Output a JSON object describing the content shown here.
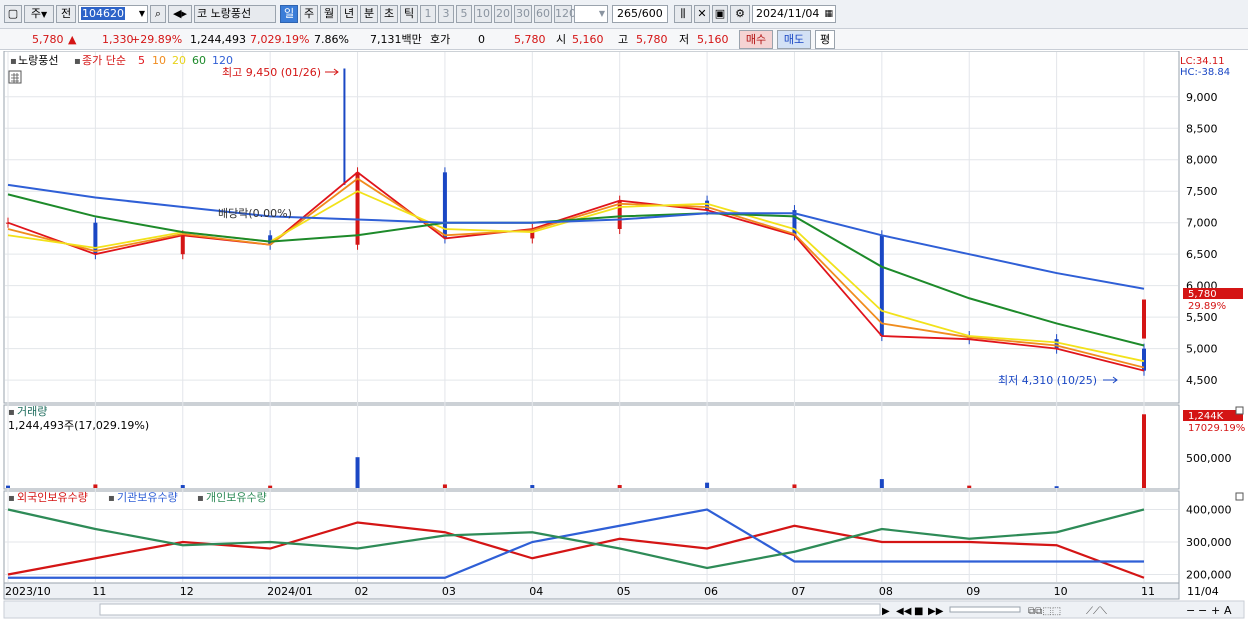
{
  "toolbar": {
    "market": "주",
    "prev_label": "전",
    "code": "104620",
    "market_short": "코",
    "stock_name": "노랑풍선",
    "period_tabs": [
      "일",
      "주",
      "월",
      "년",
      "분",
      "초",
      "틱"
    ],
    "active_period": "일",
    "interval_buttons": [
      "1",
      "3",
      "5",
      "10",
      "20",
      "30",
      "60",
      "120"
    ],
    "count": "265",
    "count_max": "/600",
    "date": "2024/11/04"
  },
  "quote": {
    "price": "5,780",
    "change": "1,330",
    "change_pct": "+29.89%",
    "volume": "1,244,493",
    "volume_ratio": "7,029.19%",
    "turnover": "7.86%",
    "amount": "7,131백만",
    "hoga_label": "호가",
    "hoga_value": "0",
    "hoga_price": "5,780",
    "open_label": "시",
    "open": "5,160",
    "high_label": "고",
    "high": "5,780",
    "low_label": "저",
    "low": "5,160",
    "buy_label": "매수",
    "sell_label": "매도",
    "avg_label": "평"
  },
  "price_panel": {
    "name": "노랑풍선",
    "ma_title": "종가 단순",
    "ma_periods": [
      "5",
      "10",
      "20",
      "60",
      "120"
    ],
    "max_label": "최고 9,450 (01/26)",
    "min_label": "최저 4,310 (10/25)",
    "dividend_label": "배당락(0.00%)",
    "lc_label": "LC:34.11",
    "hc_label": "HC:-38.84",
    "y_ticks": [
      "9,000",
      "8,500",
      "8,000",
      "7,500",
      "7,000",
      "6,500",
      "6,000",
      "5,500",
      "5,000",
      "4,500"
    ],
    "last_price_tag": "5,780",
    "last_pct_tag": "29.89%"
  },
  "volume_panel": {
    "title": "거래량",
    "subtitle": "1,244,493주(17,029.19%)",
    "y_tick": "500,000",
    "last_tag": "1,244K",
    "last_pct_tag": "17029.19%"
  },
  "holding_panel": {
    "legend": [
      "외국인보유수량",
      "기관보유수량",
      "개인보유수량"
    ],
    "y_ticks": [
      "400,000",
      "300,000",
      "200,000"
    ]
  },
  "x_axis": {
    "labels": [
      "2023/10",
      "11",
      "12",
      "2024/01",
      "02",
      "03",
      "04",
      "05",
      "06",
      "07",
      "08",
      "09",
      "10",
      "11",
      "11/04"
    ]
  },
  "colors": {
    "up": "#d41515",
    "down": "#1a47c4",
    "ma5": "#e0141b",
    "ma10": "#f08c1e",
    "ma20": "#f2e21a",
    "ma60": "#1d8a2a",
    "ma120": "#2f5fd6",
    "foreign": "#d41515",
    "institution": "#2f5fd6",
    "individual": "#2e8b57"
  },
  "chart_data": [
    {
      "type": "line",
      "title": "노랑풍선",
      "x": [
        "2023/10",
        "11",
        "12",
        "2024/01",
        "02",
        "03",
        "04",
        "05",
        "06",
        "07",
        "08",
        "09",
        "10",
        "11"
      ],
      "series": [
        {
          "name": "5",
          "values": [
            7000,
            6500,
            6800,
            6650,
            7800,
            6750,
            6900,
            7350,
            7200,
            6800,
            5200,
            5150,
            5000,
            4650
          ]
        },
        {
          "name": "10",
          "values": [
            6900,
            6550,
            6820,
            6650,
            7700,
            6800,
            6880,
            7300,
            7250,
            6820,
            5400,
            5180,
            5050,
            4700
          ]
        },
        {
          "name": "20",
          "values": [
            6800,
            6600,
            6850,
            6700,
            7500,
            6900,
            6850,
            7250,
            7300,
            6900,
            5600,
            5200,
            5100,
            4800
          ]
        },
        {
          "name": "60",
          "values": [
            7450,
            7100,
            6850,
            6700,
            6800,
            7000,
            7000,
            7100,
            7150,
            7100,
            6300,
            5800,
            5400,
            5050
          ]
        },
        {
          "name": "120",
          "values": [
            7600,
            7400,
            7250,
            7100,
            7050,
            7000,
            7000,
            7050,
            7150,
            7150,
            6800,
            6500,
            6200,
            5950
          ]
        }
      ],
      "ylim": [
        4200,
        9600
      ],
      "max_point": {
        "label": "01/26",
        "value": 9450
      },
      "min_point": {
        "label": "10/25",
        "value": 4310
      }
    },
    {
      "type": "bar",
      "title": "거래량",
      "categories": [
        "2023/10",
        "11",
        "12",
        "2024/01",
        "02",
        "03",
        "04",
        "05",
        "06",
        "07",
        "08",
        "09",
        "10",
        "11"
      ],
      "values": [
        40000,
        60000,
        50000,
        40000,
        520000,
        60000,
        50000,
        50000,
        90000,
        60000,
        150000,
        40000,
        30000,
        1244493
      ],
      "ylim": [
        0,
        1300000
      ]
    },
    {
      "type": "line",
      "x": [
        "2023/10",
        "11",
        "12",
        "2024/01",
        "02",
        "03",
        "04",
        "05",
        "06",
        "07",
        "08",
        "09",
        "10",
        "11"
      ],
      "series": [
        {
          "name": "외국인보유수량",
          "values": [
            200000,
            250000,
            300000,
            280000,
            360000,
            330000,
            250000,
            310000,
            280000,
            350000,
            300000,
            300000,
            290000,
            190000
          ]
        },
        {
          "name": "기관보유수량",
          "values": [
            190000,
            190000,
            190000,
            190000,
            190000,
            190000,
            300000,
            350000,
            400000,
            240000,
            240000,
            240000,
            240000,
            240000
          ]
        },
        {
          "name": "개인보유수량",
          "values": [
            400000,
            340000,
            290000,
            300000,
            280000,
            320000,
            330000,
            280000,
            220000,
            270000,
            340000,
            310000,
            330000,
            400000
          ]
        }
      ],
      "ylim": [
        180000,
        420000
      ]
    }
  ]
}
